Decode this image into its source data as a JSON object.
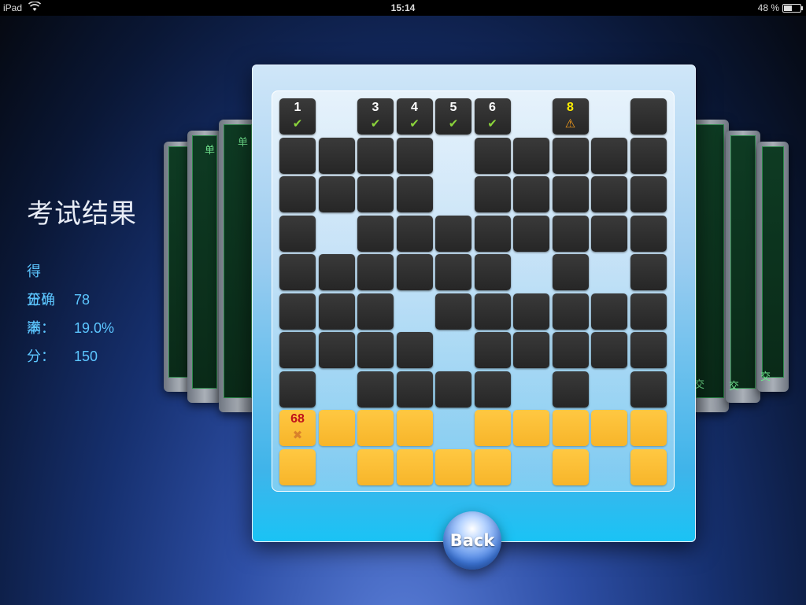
{
  "status": {
    "carrier": "iPad",
    "time": "15:14",
    "battery": "48 %",
    "battery_level": 0.48
  },
  "result": {
    "title": "考试结果",
    "score_label": "得　分：",
    "score": "78",
    "accuracy_label": "正确率：",
    "accuracy": "19.0%",
    "full_label": "满　分：",
    "full": "150"
  },
  "back_label": "Back",
  "bg_labels": {
    "single": "单",
    "submit": "交"
  },
  "colors": {
    "dark_cell": "#2f2f2f",
    "yellow_cell": "#fbbf36",
    "check": "#8bd43b",
    "number_red": "#c0121a",
    "number_warn": "#ffee00"
  },
  "grid": {
    "rows": [
      [
        {
          "t": "d",
          "n": "1",
          "m": "check"
        },
        {
          "t": "e"
        },
        {
          "t": "d",
          "n": "3",
          "m": "check"
        },
        {
          "t": "d",
          "n": "4",
          "m": "check"
        },
        {
          "t": "d",
          "n": "5",
          "m": "check"
        },
        {
          "t": "d",
          "n": "6",
          "m": "check"
        },
        {
          "t": "e"
        },
        {
          "t": "d",
          "n": "8",
          "m": "warn"
        },
        {
          "t": "e"
        },
        {
          "t": "d"
        }
      ],
      [
        {
          "t": "d"
        },
        {
          "t": "d"
        },
        {
          "t": "d"
        },
        {
          "t": "d"
        },
        {
          "t": "e"
        },
        {
          "t": "d"
        },
        {
          "t": "d"
        },
        {
          "t": "d"
        },
        {
          "t": "d"
        },
        {
          "t": "d"
        }
      ],
      [
        {
          "t": "d"
        },
        {
          "t": "d"
        },
        {
          "t": "d"
        },
        {
          "t": "d"
        },
        {
          "t": "e"
        },
        {
          "t": "d"
        },
        {
          "t": "d"
        },
        {
          "t": "d"
        },
        {
          "t": "d"
        },
        {
          "t": "d"
        }
      ],
      [
        {
          "t": "d"
        },
        {
          "t": "e"
        },
        {
          "t": "d"
        },
        {
          "t": "d"
        },
        {
          "t": "d"
        },
        {
          "t": "d"
        },
        {
          "t": "d"
        },
        {
          "t": "d"
        },
        {
          "t": "d"
        },
        {
          "t": "d"
        }
      ],
      [
        {
          "t": "d"
        },
        {
          "t": "d"
        },
        {
          "t": "d"
        },
        {
          "t": "d"
        },
        {
          "t": "d"
        },
        {
          "t": "d"
        },
        {
          "t": "e"
        },
        {
          "t": "d"
        },
        {
          "t": "e"
        },
        {
          "t": "d"
        }
      ],
      [
        {
          "t": "d"
        },
        {
          "t": "d"
        },
        {
          "t": "d"
        },
        {
          "t": "e"
        },
        {
          "t": "d"
        },
        {
          "t": "d"
        },
        {
          "t": "d"
        },
        {
          "t": "d"
        },
        {
          "t": "d"
        },
        {
          "t": "d"
        }
      ],
      [
        {
          "t": "d"
        },
        {
          "t": "d"
        },
        {
          "t": "d"
        },
        {
          "t": "d"
        },
        {
          "t": "e"
        },
        {
          "t": "d"
        },
        {
          "t": "d"
        },
        {
          "t": "d"
        },
        {
          "t": "d"
        },
        {
          "t": "d"
        }
      ],
      [
        {
          "t": "d"
        },
        {
          "t": "e"
        },
        {
          "t": "d"
        },
        {
          "t": "d"
        },
        {
          "t": "d"
        },
        {
          "t": "d"
        },
        {
          "t": "e"
        },
        {
          "t": "d"
        },
        {
          "t": "e"
        },
        {
          "t": "d"
        }
      ],
      [
        {
          "t": "y",
          "n": "68",
          "m": "wrong"
        },
        {
          "t": "y"
        },
        {
          "t": "y"
        },
        {
          "t": "y"
        },
        {
          "t": "e"
        },
        {
          "t": "y"
        },
        {
          "t": "y"
        },
        {
          "t": "y"
        },
        {
          "t": "y"
        },
        {
          "t": "y"
        }
      ],
      [
        {
          "t": "y"
        },
        {
          "t": "e"
        },
        {
          "t": "y"
        },
        {
          "t": "y"
        },
        {
          "t": "y"
        },
        {
          "t": "y"
        },
        {
          "t": "e"
        },
        {
          "t": "y"
        },
        {
          "t": "e"
        },
        {
          "t": "y"
        }
      ]
    ]
  }
}
